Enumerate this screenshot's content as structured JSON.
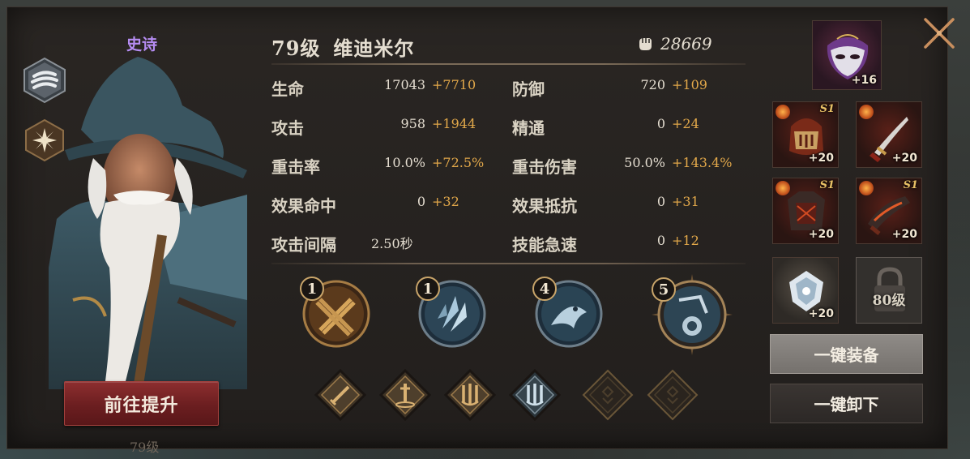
{
  "hero": {
    "rarity": "史诗",
    "level": "79级",
    "name": "维迪米尔",
    "power": "28669",
    "upgrade_label": "前往提升",
    "under_label": "79级"
  },
  "stats": [
    {
      "label": "生命",
      "base": "17043",
      "bonus": "+7710"
    },
    {
      "label": "防御",
      "base": "720",
      "bonus": "+109"
    },
    {
      "label": "攻击",
      "base": "958",
      "bonus": "+1944"
    },
    {
      "label": "精通",
      "base": "0",
      "bonus": "+24"
    },
    {
      "label": "重击率",
      "base": "10.0%",
      "bonus": "+72.5%"
    },
    {
      "label": "重击伤害",
      "base": "50.0%",
      "bonus": "+143.4%"
    },
    {
      "label": "效果命中",
      "base": "0",
      "bonus": "+32"
    },
    {
      "label": "效果抵抗",
      "base": "0",
      "bonus": "+31"
    },
    {
      "label": "攻击间隔",
      "base": "2.50秒",
      "bonus": ""
    },
    {
      "label": "技能急速",
      "base": "0",
      "bonus": "+12"
    }
  ],
  "skills": [
    {
      "level": "1",
      "icon": "crossed-swords-icon"
    },
    {
      "level": "1",
      "icon": "crystal-claw-icon"
    },
    {
      "level": "4",
      "icon": "shadow-beast-icon"
    },
    {
      "level": "5",
      "icon": "chain-orb-icon"
    }
  ],
  "runes": [
    {
      "icon": "sword-rune-icon",
      "locked": false
    },
    {
      "icon": "altar-sword-rune-icon",
      "locked": false
    },
    {
      "icon": "triple-blade-gold-rune-icon",
      "locked": false
    },
    {
      "icon": "triple-blade-blue-rune-icon",
      "locked": false
    },
    {
      "icon": "empty-rune-icon",
      "locked": true
    },
    {
      "icon": "empty-rune-icon",
      "locked": true
    }
  ],
  "equipment": {
    "mask": {
      "plus": "+16",
      "icon": "purple-mask-icon"
    },
    "helmet": {
      "plus": "+20",
      "tier": "S1",
      "icon": "horned-helmet-icon"
    },
    "dagger": {
      "plus": "+20",
      "tier": "",
      "icon": "crimson-dagger-icon"
    },
    "armor": {
      "plus": "+20",
      "tier": "S1",
      "icon": "dark-armor-icon"
    },
    "gauntlet": {
      "plus": "+20",
      "tier": "S1",
      "icon": "flame-gauntlet-icon"
    },
    "gem": {
      "plus": "+20",
      "icon": "white-gem-icon"
    },
    "locked_slot_label": "80级"
  },
  "buttons": {
    "equip_all": "一键装备",
    "unequip_all": "一键卸下"
  },
  "colors": {
    "rarity_epic": "#b58cf2",
    "bonus_gold": "#e2a84a",
    "upgrade_red": "#8d2e2f"
  }
}
